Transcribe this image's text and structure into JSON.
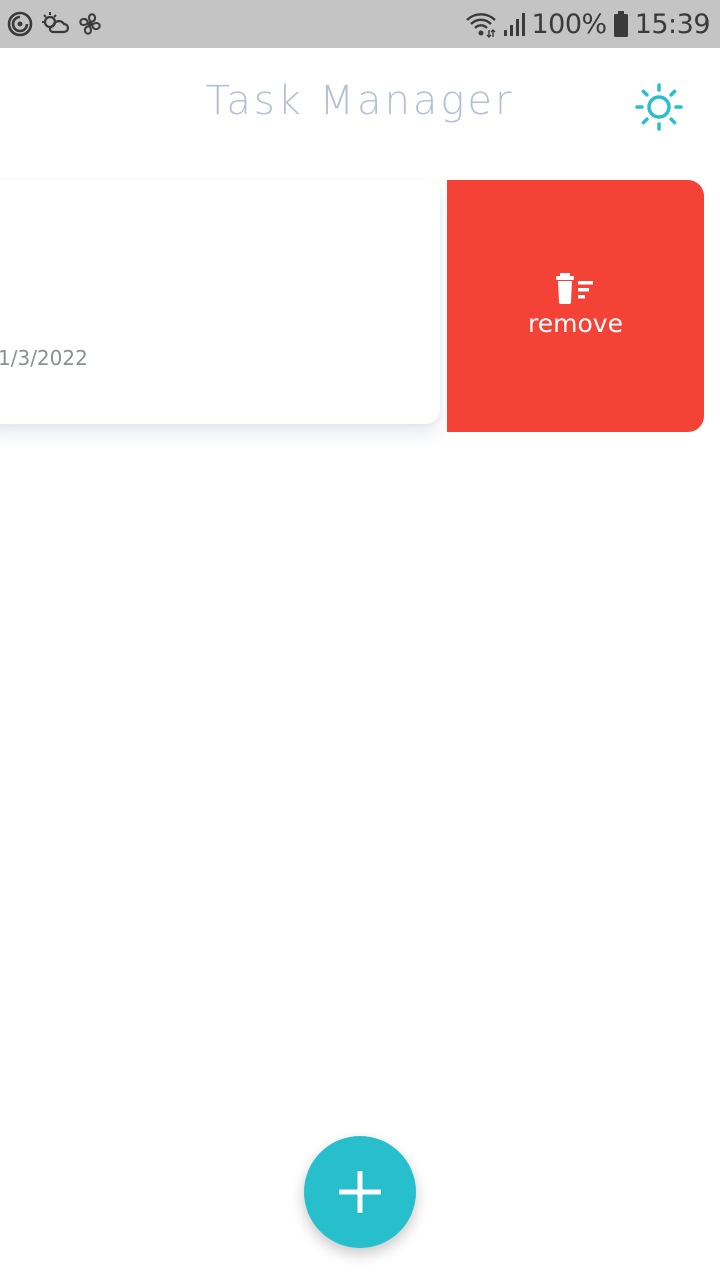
{
  "status_bar": {
    "left_icons": [
      "sync-icon",
      "weather-icon",
      "fan-icon"
    ],
    "right_icons": [
      "wifi-icon",
      "signal-icon",
      "battery-icon"
    ],
    "battery_text": "100%",
    "time": "15:39"
  },
  "app_bar": {
    "title": "Task Manager",
    "theme_icon": "sun-icon"
  },
  "task": {
    "date": "1/3/2022"
  },
  "swipe_action": {
    "label": "remove",
    "icon": "trash-icon",
    "color": "#f44336"
  },
  "fab": {
    "icon": "plus-icon",
    "color": "#26bfcb"
  },
  "colors": {
    "accent": "#26bfcb",
    "title": "#b4c0d6",
    "status_bar": "#c4c4c4"
  }
}
